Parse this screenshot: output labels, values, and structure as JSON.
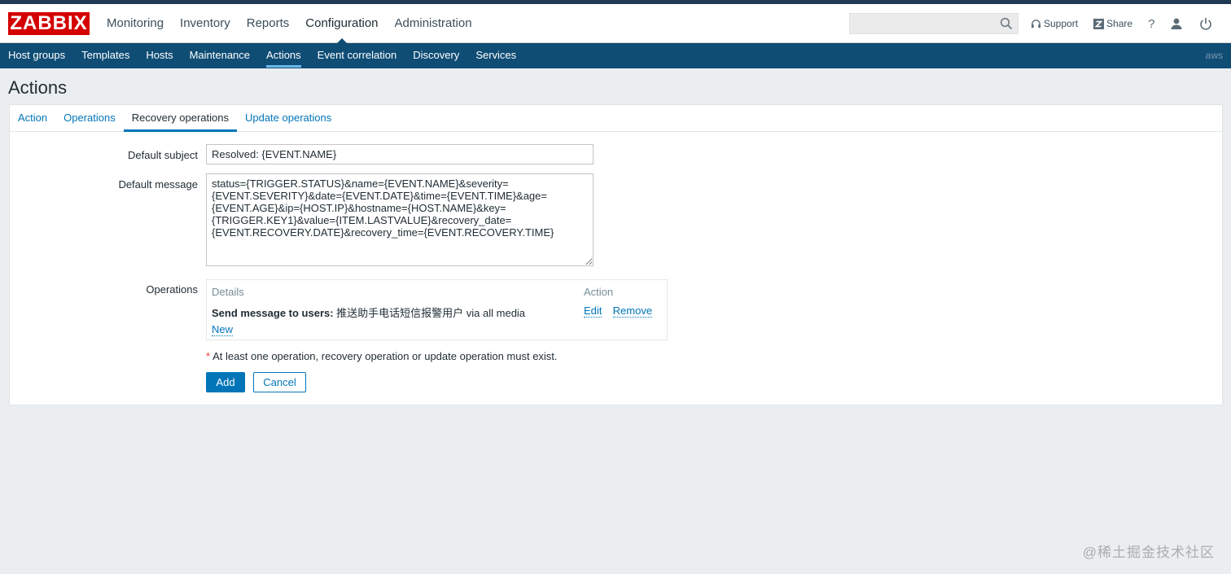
{
  "logo": "ZABBIX",
  "main_menu": [
    {
      "label": "Monitoring"
    },
    {
      "label": "Inventory"
    },
    {
      "label": "Reports"
    },
    {
      "label": "Configuration"
    },
    {
      "label": "Administration"
    }
  ],
  "main_menu_selected": "Configuration",
  "search": {
    "value": "",
    "placeholder": ""
  },
  "header_links": {
    "support": "Support",
    "share": "Share",
    "help": "?"
  },
  "sub_menu": [
    {
      "label": "Host groups"
    },
    {
      "label": "Templates"
    },
    {
      "label": "Hosts"
    },
    {
      "label": "Maintenance"
    },
    {
      "label": "Actions"
    },
    {
      "label": "Event correlation"
    },
    {
      "label": "Discovery"
    },
    {
      "label": "Services"
    }
  ],
  "sub_menu_selected": "Actions",
  "server_name": "aws",
  "page_title": "Actions",
  "tabs": [
    {
      "label": "Action"
    },
    {
      "label": "Operations"
    },
    {
      "label": "Recovery operations"
    },
    {
      "label": "Update operations"
    }
  ],
  "selected_tab": "Recovery operations",
  "form": {
    "default_subject_label": "Default subject",
    "default_subject_value": "Resolved: {EVENT.NAME}",
    "default_message_label": "Default message",
    "default_message_value": "status={TRIGGER.STATUS}&name={EVENT.NAME}&severity={EVENT.SEVERITY}&date={EVENT.DATE}&time={EVENT.TIME}&age={EVENT.AGE}&ip={HOST.IP}&hostname={HOST.NAME}&key={TRIGGER.KEY1}&value={ITEM.LASTVALUE}&recovery_date={EVENT.RECOVERY.DATE}&recovery_time={EVENT.RECOVERY.TIME}",
    "operations_label": "Operations",
    "operations": {
      "col_details": "Details",
      "col_action": "Action",
      "row": {
        "details_bold": "Send message to users:",
        "details_rest": " 推送助手电话短信报警用户 via all media",
        "edit": "Edit",
        "remove": "Remove"
      },
      "new": "New"
    },
    "required_star": "*",
    "required_note": "At least one operation, recovery operation or update operation must exist.",
    "add_button": "Add",
    "cancel_button": "Cancel"
  },
  "watermark": "@稀土掘金技术社区",
  "colors": {
    "brand_red": "#d40000",
    "nav_blue": "#0f4d75",
    "link_blue": "#0275b8",
    "tab_underline": "#6db8ea"
  }
}
